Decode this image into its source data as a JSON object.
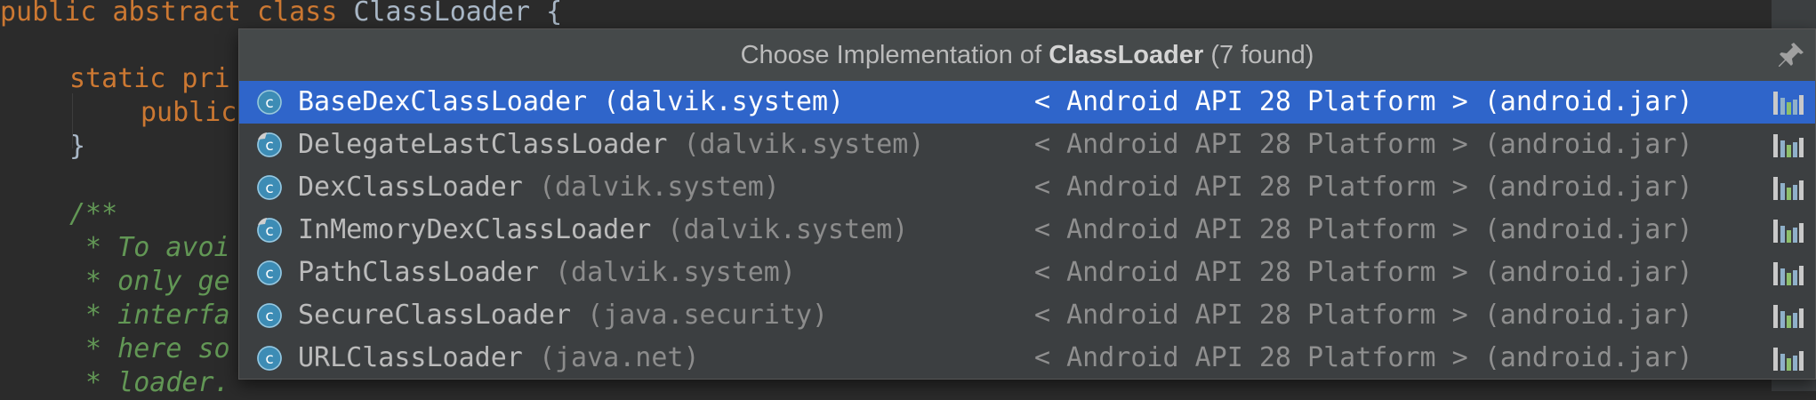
{
  "editor": {
    "lines": [
      {
        "kw": "public abstract class ",
        "cls": "ClassLoader {"
      },
      {
        "kw": "static pri",
        "cls": ""
      },
      {
        "kw": "public",
        "cls": ""
      },
      {
        "kw": "",
        "cls": "}"
      },
      {
        "cmt": "/**"
      },
      {
        "cmt": " * To avoi"
      },
      {
        "cmt": " * only ge"
      },
      {
        "cmt": " * interfa"
      },
      {
        "cmt": " * here so"
      },
      {
        "cmt": " * loader."
      }
    ]
  },
  "popup": {
    "title_prefix": "Choose Implementation of ",
    "title_class": "ClassLoader",
    "title_suffix": " (7 found)",
    "pin_icon": "pin-icon",
    "items": [
      {
        "name": "BaseDexClassLoader",
        "package": "(dalvik.system)",
        "location": "< Android API 28 Platform > (android.jar)",
        "icon": "class-icon",
        "selected": true
      },
      {
        "name": "DelegateLastClassLoader",
        "package": "(dalvik.system)",
        "location": "< Android API 28 Platform > (android.jar)",
        "icon": "class-icon",
        "selected": false
      },
      {
        "name": "DexClassLoader",
        "package": "(dalvik.system)",
        "location": "< Android API 28 Platform > (android.jar)",
        "icon": "class-icon",
        "selected": false
      },
      {
        "name": "InMemoryDexClassLoader",
        "package": "(dalvik.system)",
        "location": "< Android API 28 Platform > (android.jar)",
        "icon": "class-icon",
        "selected": false
      },
      {
        "name": "PathClassLoader",
        "package": "(dalvik.system)",
        "location": "< Android API 28 Platform > (android.jar)",
        "icon": "class-icon",
        "selected": false
      },
      {
        "name": "SecureClassLoader",
        "package": "(java.security)",
        "location": "< Android API 28 Platform > (android.jar)",
        "icon": "class-icon",
        "selected": false
      },
      {
        "name": "URLClassLoader",
        "package": "(java.net)",
        "location": "< Android API 28 Platform > (android.jar)",
        "icon": "class-icon",
        "selected": false
      }
    ]
  },
  "colors": {
    "selection": "#2f65ca",
    "keyword": "#cc7832",
    "comment": "#629755",
    "popup_bg": "#3c3f41",
    "editor_bg": "#2b2b2b"
  }
}
